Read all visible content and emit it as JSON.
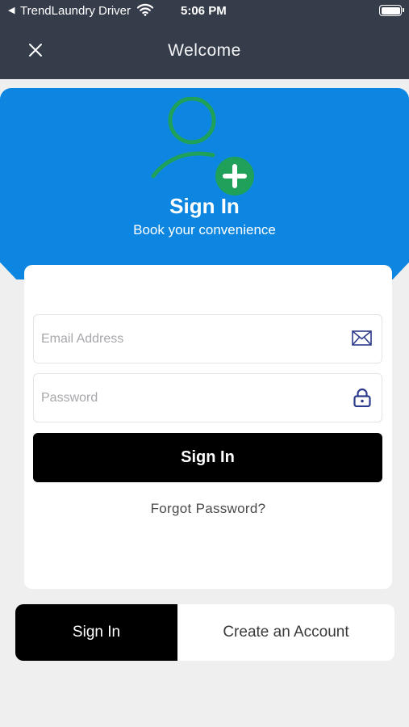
{
  "status_bar": {
    "back_glyph": "◀",
    "app_name": "TrendLaundry Driver",
    "time": "5:06 PM",
    "icons": [
      "wifi-icon",
      "battery-icon"
    ]
  },
  "nav": {
    "title": "Welcome",
    "close_icon": "close-icon"
  },
  "hero": {
    "title": "Sign In",
    "subtitle": "Book your convenience",
    "icon": "add-user-icon",
    "colors": {
      "background": "#0c86e0",
      "icon_green": "#1fa15a"
    }
  },
  "form": {
    "email": {
      "value": "",
      "placeholder": "Email Address",
      "icon": "envelope-icon"
    },
    "password": {
      "value": "",
      "placeholder": "Password",
      "icon": "lock-icon"
    },
    "submit_label": "Sign In",
    "forgot_label": "Forgot Password?"
  },
  "tabs": [
    {
      "label": "Sign In",
      "active": true
    },
    {
      "label": "Create an Account",
      "active": false
    }
  ],
  "colors": {
    "header": "#363d4a",
    "page_background": "#efeff0",
    "primary_button": "#000000",
    "field_icon": "#2b3a8c"
  }
}
